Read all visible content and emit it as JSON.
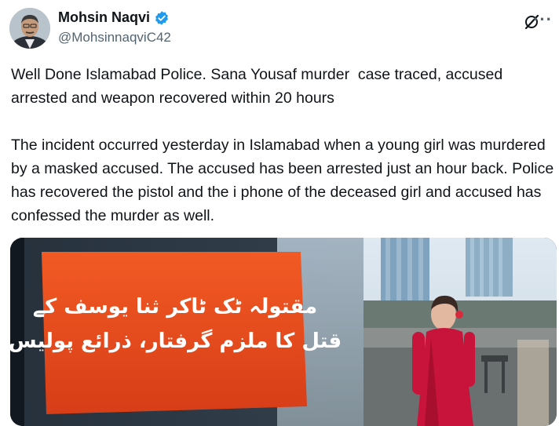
{
  "author": {
    "display_name": "Mohsin Naqvi",
    "handle": "@MohsinnaqviC42",
    "verified": true,
    "verified_color": "#1d9bf0"
  },
  "actions": {
    "grok_icon": "grok-icon",
    "more_icon": "more-icon"
  },
  "tweet": {
    "text": "Well Done Islamabad Police. Sana Yousaf murder  case traced, accused arrested and weapon recovered within 20 hours\n\nThe incident occurred yesterday in Islamabad when a young girl was murdered by a masked accused. The accused has been arrested just an hour back. Police has recovered the pistol and the i phone of the deceased girl and accused has confessed the murder as well."
  },
  "media": {
    "banner_line_1": "مقتولہ ٹک ٹاکر ثنا یوسف کے",
    "banner_line_2": "قتل کا ملزم گرفتار، ذرائع پولیس",
    "banner_color": "#e8471c"
  }
}
